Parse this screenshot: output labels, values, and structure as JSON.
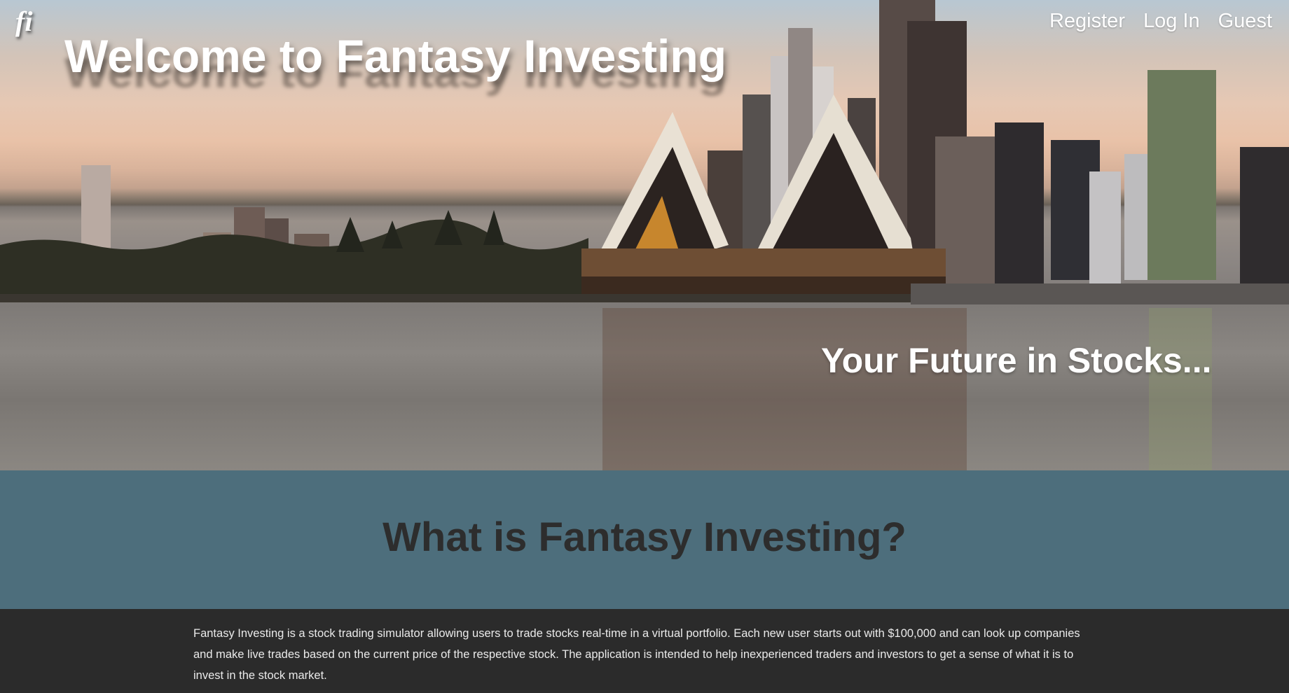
{
  "logo": {
    "text": "fi"
  },
  "nav": {
    "register": "Register",
    "login": "Log In",
    "guest": "Guest"
  },
  "hero": {
    "title": "Welcome to Fantasy Investing",
    "tagline": "Your Future in Stocks..."
  },
  "what": {
    "heading": "What is Fantasy Investing?"
  },
  "about": {
    "body": "Fantasy Investing is a stock trading simulator allowing users to trade stocks real-time in a virtual portfolio. Each new user starts out with $100,000 and can look up companies and make live trades based on the current price of the respective stock. The application is intended to help inexperienced traders and investors to get a sense of what it is to invest in the stock market."
  },
  "colors": {
    "section_blue": "#4d6e7c",
    "footer_dark": "#2b2b2b",
    "heading_dark": "#2d2d2d"
  }
}
